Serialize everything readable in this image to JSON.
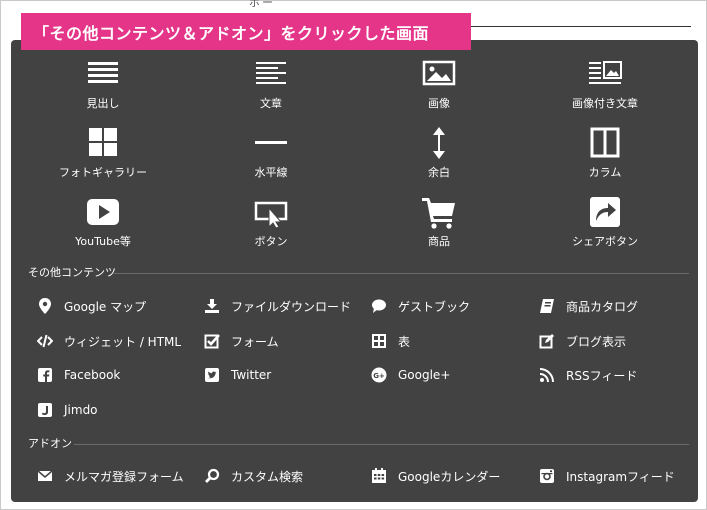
{
  "banner": {
    "title": "「その他コンテンツ＆アドオン」をクリックした画面"
  },
  "top_stub": "ボー",
  "tiles": [
    {
      "label": "見出し",
      "icon": "heading-icon"
    },
    {
      "label": "文章",
      "icon": "text-icon"
    },
    {
      "label": "画像",
      "icon": "image-icon"
    },
    {
      "label": "画像付き文章",
      "icon": "image-text-icon"
    },
    {
      "label": "フォトギャラリー",
      "icon": "photo-gallery-icon"
    },
    {
      "label": "水平線",
      "icon": "horizontal-line-icon"
    },
    {
      "label": "余白",
      "icon": "spacing-icon"
    },
    {
      "label": "カラム",
      "icon": "column-icon"
    },
    {
      "label": "YouTube等",
      "icon": "youtube-play-icon"
    },
    {
      "label": "ボタン",
      "icon": "button-cursor-icon"
    },
    {
      "label": "商品",
      "icon": "cart-icon"
    },
    {
      "label": "シェアボタン",
      "icon": "share-icon"
    }
  ],
  "other_contents": {
    "title": "その他コンテンツ",
    "items": [
      {
        "label": "Google マップ",
        "icon": "map-pin-icon"
      },
      {
        "label": "ファイルダウンロード",
        "icon": "download-icon"
      },
      {
        "label": "ゲストブック",
        "icon": "comment-icon"
      },
      {
        "label": "商品カタログ",
        "icon": "catalog-icon"
      },
      {
        "label": "ウィジェット / HTML",
        "icon": "code-icon"
      },
      {
        "label": "フォーム",
        "icon": "checkbox-icon"
      },
      {
        "label": "表",
        "icon": "table-icon"
      },
      {
        "label": "ブログ表示",
        "icon": "edit-icon"
      },
      {
        "label": "Facebook",
        "icon": "facebook-icon"
      },
      {
        "label": "Twitter",
        "icon": "twitter-icon"
      },
      {
        "label": "Google+",
        "icon": "google-plus-icon"
      },
      {
        "label": "RSSフィード",
        "icon": "rss-icon"
      },
      {
        "label": "Jimdo",
        "icon": "jimdo-icon"
      }
    ]
  },
  "addons": {
    "title": "アドオン",
    "items": [
      {
        "label": "メルマガ登録フォーム",
        "icon": "envelope-icon"
      },
      {
        "label": "カスタム検索",
        "icon": "search-icon"
      },
      {
        "label": "Googleカレンダー",
        "icon": "calendar-icon"
      },
      {
        "label": "Instagramフィード",
        "icon": "instagram-icon"
      }
    ]
  }
}
